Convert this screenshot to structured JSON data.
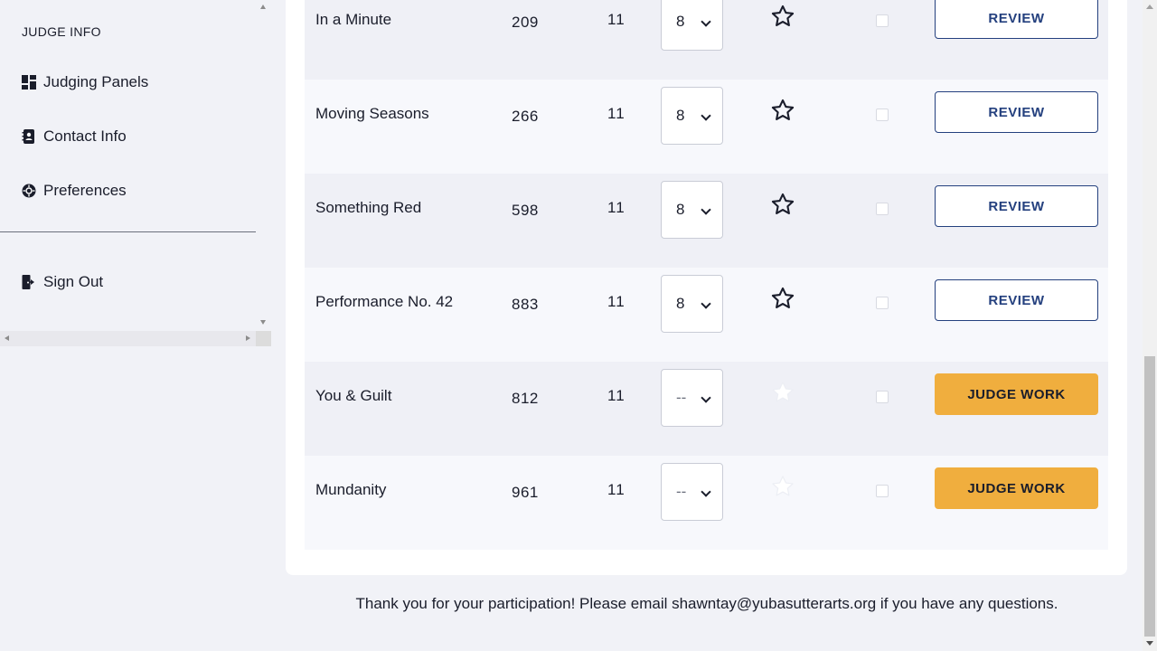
{
  "sidebar": {
    "section_label": "JUDGE INFO",
    "items": [
      {
        "label": "Judging Panels",
        "icon": "dashboard-icon"
      },
      {
        "label": "Contact Info",
        "icon": "contact-book-icon"
      },
      {
        "label": "Preferences",
        "icon": "gear-icon"
      }
    ],
    "sign_out": {
      "label": "Sign Out",
      "icon": "sign-out-icon"
    }
  },
  "rows": [
    {
      "title": "In a Minute",
      "id": "209",
      "num": "11",
      "score": "8",
      "starred": false,
      "star_style": "outline",
      "action": "REVIEW"
    },
    {
      "title": "Moving Seasons",
      "id": "266",
      "num": "11",
      "score": "8",
      "starred": false,
      "star_style": "outline",
      "action": "REVIEW"
    },
    {
      "title": "Something Red",
      "id": "598",
      "num": "11",
      "score": "8",
      "starred": false,
      "star_style": "outline",
      "action": "REVIEW"
    },
    {
      "title": "Performance No. 42",
      "id": "883",
      "num": "11",
      "score": "8",
      "starred": false,
      "star_style": "outline",
      "action": "REVIEW"
    },
    {
      "title": "You & Guilt",
      "id": "812",
      "num": "11",
      "score": "--",
      "starred": false,
      "star_style": "faint",
      "action": "JUDGE WORK"
    },
    {
      "title": "Mundanity",
      "id": "961",
      "num": "11",
      "score": "--",
      "starred": false,
      "star_style": "faint",
      "action": "JUDGE WORK"
    }
  ],
  "footer": {
    "text": "Thank you for your participation! Please email shawntay@yubasutterarts.org if you have any questions."
  },
  "colors": {
    "accent_navy": "#24407e",
    "accent_orange": "#f0ae3e",
    "background": "#f1f2f7"
  }
}
